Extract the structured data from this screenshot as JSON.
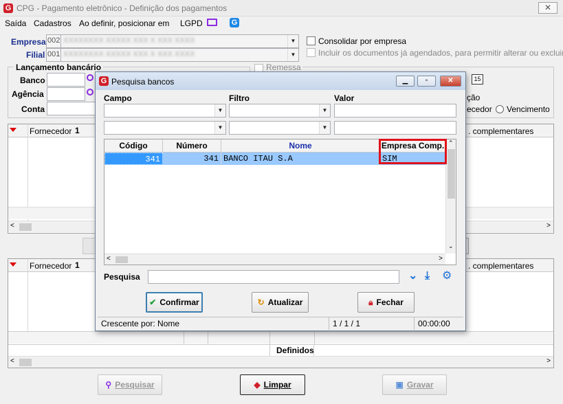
{
  "window": {
    "title": "CPG - Pagamento eletrônico - Definição dos pagamentos",
    "close_glyph": "✕"
  },
  "menu": {
    "items": [
      "Saída",
      "Cadastros",
      "Ao definir, posicionar em",
      "LGPD"
    ]
  },
  "form": {
    "empresa_label": "Empresa",
    "empresa_code": "002",
    "empresa_name": "XXXXXXXX XXXXX XXX X XXX XXXX",
    "filial_label": "Filial",
    "filial_code": "001",
    "filial_name": "XXXXXXXX XXXXX XXX X XXX XXXX",
    "consolidar_label": "Consolidar por empresa",
    "incluir_label": "Incluir os documentos já agendados, para permitir alterar ou excluir",
    "lancamento_title": "Lançamento bancário",
    "banco_label": "Banco",
    "agencia_label": "Agência",
    "conta_label": "Conta",
    "remessa_label": "Remessa",
    "ordenacao_partial": "ção",
    "fornecedor_partial": "ecedor",
    "vencimento_label": "Vencimento"
  },
  "grid_top": {
    "col_fornecedor": "Fornecedor",
    "sort_num": "1",
    "col_complementares": ". complementares"
  },
  "grid_bottom": {
    "col_fornecedor": "Fornecedor",
    "sort_num": "1",
    "col_complementares": ". complementares",
    "footer_label": "Definidos"
  },
  "buttons": {
    "pesquisar": "Pesquisar",
    "limpar": "Limpar",
    "gravar": "Gravar"
  },
  "dialog": {
    "title": "Pesquisa bancos",
    "filter_headers": {
      "campo": "Campo",
      "filtro": "Filtro",
      "valor": "Valor"
    },
    "columns": [
      "Código",
      "Número",
      "Nome",
      "Empresa Comp."
    ],
    "rows": [
      {
        "codigo": "341",
        "numero": "341",
        "nome": "BANCO ITAU S.A",
        "empresa_comp": "SIM"
      }
    ],
    "pesquisa_label": "Pesquisa",
    "pesquisa_value": "",
    "confirmar": "Confirmar",
    "atualizar": "Atualizar",
    "fechar": "Fechar",
    "status": {
      "order": "Crescente por: Nome",
      "position": "1 / 1 / 1",
      "time": "00:00:00"
    }
  },
  "colors": {
    "accent_red": "#d0202a",
    "selection_blue": "#3399ff",
    "highlight_border": "#e0121c",
    "title_blue": "#1a2f8f"
  }
}
